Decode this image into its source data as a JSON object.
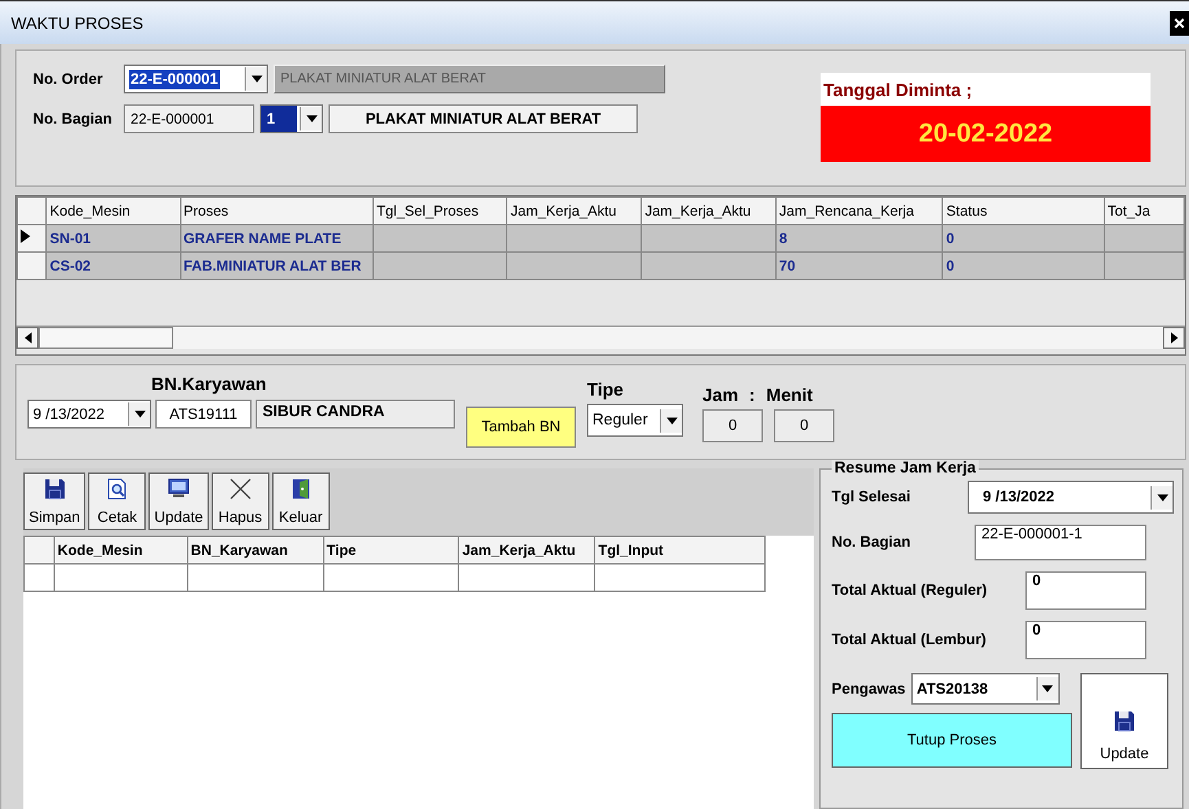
{
  "window": {
    "title": "WAKTU PROSES"
  },
  "order": {
    "label": "No. Order",
    "value": "22-E-000001",
    "description": "PLAKAT MINIATUR ALAT BERAT"
  },
  "bagian": {
    "label": "No. Bagian",
    "value": "22-E-000001",
    "sequence": "1",
    "description": "PLAKAT MINIATUR ALAT BERAT"
  },
  "requested_date": {
    "label": "Tanggal Diminta ;",
    "value": "20-02-2022"
  },
  "process_table": {
    "columns": [
      "Kode_Mesin",
      "Proses",
      "Tgl_Sel_Proses",
      "Jam_Kerja_Aktu",
      "Jam_Kerja_Aktu",
      "Jam_Rencana_Kerja",
      "Status",
      "Tot_Ja"
    ],
    "rows": [
      {
        "selected": true,
        "cells": [
          "SN-01",
          "GRAFER NAME PLATE",
          "",
          "",
          "",
          "8",
          "0",
          ""
        ]
      },
      {
        "selected": false,
        "cells": [
          "CS-02",
          "FAB.MINIATUR ALAT BER",
          "",
          "",
          "",
          "70",
          "0",
          ""
        ]
      }
    ]
  },
  "employee": {
    "heading": "BN.Karyawan",
    "date": "9 /13/2022",
    "id": "ATS19111",
    "name": "SIBUR CANDRA",
    "add_button": "Tambah BN",
    "type_label": "Tipe",
    "type": "Reguler",
    "hour_label": "Jam",
    "separator": ":",
    "minute_label": "Menit",
    "hour": "0",
    "minute": "0"
  },
  "toolbar": [
    {
      "label": "Simpan",
      "kind": "save"
    },
    {
      "label": "Cetak",
      "kind": "print"
    },
    {
      "label": "Update",
      "kind": "update"
    },
    {
      "label": "Hapus",
      "kind": "delete"
    },
    {
      "label": "Keluar",
      "kind": "exit"
    }
  ],
  "input_table": {
    "columns": [
      "Kode_Mesin",
      "BN_Karyawan",
      "Tipe",
      "Jam_Kerja_Aktu",
      "Tgl_Input"
    ]
  },
  "resume": {
    "title": "Resume Jam Kerja",
    "finish_date_label": "Tgl Selesai",
    "finish_date": "9 /13/2022",
    "bagian_label": "No. Bagian",
    "bagian": "22-E-000001-1",
    "regular_label": "Total Aktual (Reguler)",
    "regular": "0",
    "overtime_label": "Total Aktual (Lembur)",
    "overtime": "0",
    "supervisor_label": "Pengawas",
    "supervisor": "ATS20138",
    "close_button": "Tutup Proses",
    "update_button": "Update"
  }
}
